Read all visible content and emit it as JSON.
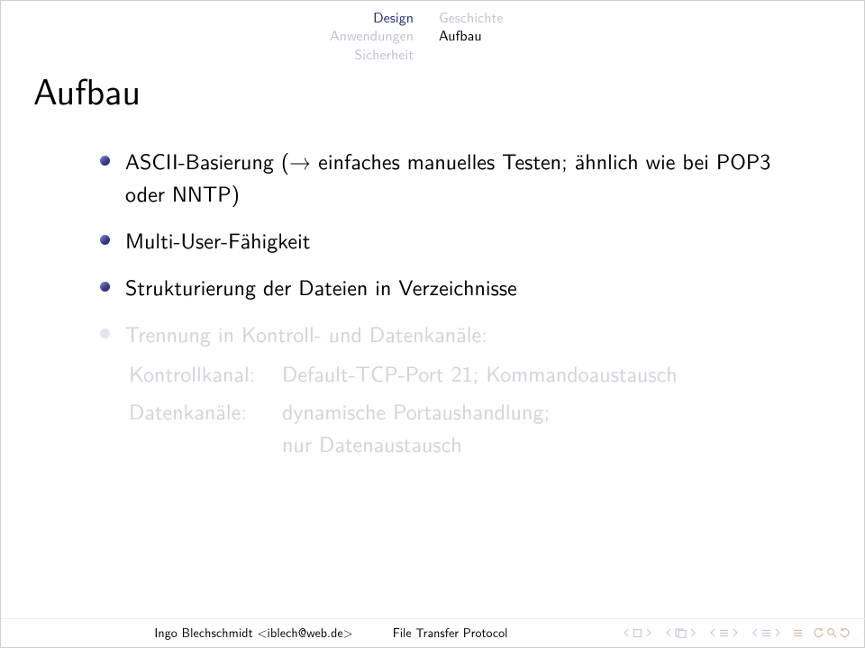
{
  "topnav": {
    "left": {
      "l1": "Design",
      "l2": "Anwendungen",
      "l3": "Sicherheit"
    },
    "right": {
      "l1": "Geschichte",
      "l2": "Aufbau"
    }
  },
  "frametitle": "Aufbau",
  "bullets": {
    "b1": "ASCII-Basierung (→ einfaches manuelles Testen; ähnlich wie bei POP3 oder NNTP)",
    "b2": "Multi-User-Fähigkeit",
    "b3": "Strukturierung der Dateien in Verzeichnisse",
    "b4": "Trennung in Kontroll- und Datenkanäle:",
    "desc": {
      "t1": "Kontrollkanal:",
      "d1": "Default-TCP-Port 21; Kommandoaustausch",
      "t2": "Datenkanäle:",
      "d2a": "dynamische Portaushandlung;",
      "d2b": "nur Datenaustausch"
    }
  },
  "footer": {
    "author": "Ingo Blechschmidt <iblech@web.de>",
    "title": "File Transfer Protocol"
  }
}
